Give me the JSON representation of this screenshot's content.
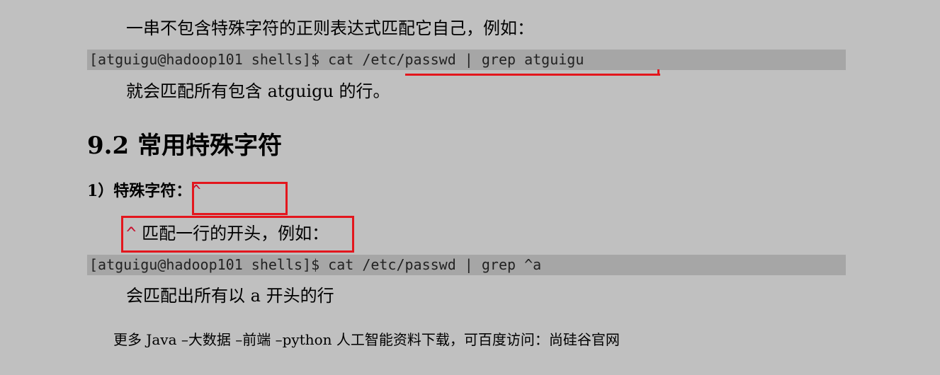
{
  "intro_text": "一串不包含特殊字符的正则表达式匹配它自己，例如：",
  "code1": "[atguigu@hadoop101 shells]$ cat /etc/passwd | grep atguigu",
  "after_code1_text": "就会匹配所有包含 atguigu 的行。",
  "section_number": "9.2",
  "section_title": "常用特殊字符",
  "sub_label": "1）特殊字符：",
  "sub_symbol": "^",
  "caret_symbol": "^",
  "caret_desc": " 匹配一行的开头，例如：",
  "code2": "[atguigu@hadoop101 shells]$ cat /etc/passwd | grep ^a",
  "after_code2_text": "会匹配出所有以 a 开头的行",
  "footer": "更多 Java –大数据 –前端 –python 人工智能资料下载，可百度访问：尚硅谷官网",
  "colors": {
    "background": "#c0c0c0",
    "code_background": "#a6a6a6",
    "annotation_red": "#e3161d",
    "caret_red": "#c8102e"
  }
}
